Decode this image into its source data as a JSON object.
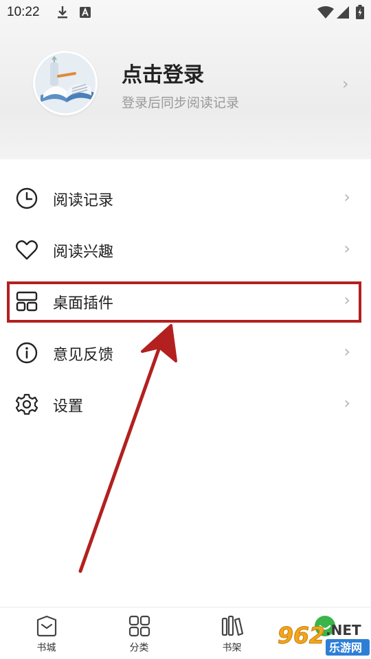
{
  "status_bar": {
    "time": "10:22",
    "icons": [
      "download-icon",
      "a-icon",
      "wifi-icon",
      "signal-icon",
      "battery-icon"
    ]
  },
  "profile": {
    "title": "点击登录",
    "subtitle": "登录后同步阅读记录",
    "avatar_icon": "book-avatar-icon"
  },
  "menu": {
    "items": [
      {
        "label": "阅读记录",
        "icon": "clock-icon"
      },
      {
        "label": "阅读兴趣",
        "icon": "heart-icon"
      },
      {
        "label": "桌面插件",
        "icon": "widget-icon"
      },
      {
        "label": "意见反馈",
        "icon": "info-icon"
      },
      {
        "label": "设置",
        "icon": "gear-icon"
      }
    ],
    "highlighted_item": "桌面插件"
  },
  "annotation": {
    "highlight_color": "#b3201f"
  },
  "bottom_nav": {
    "items": [
      {
        "label": "书城",
        "icon": "bookstore-icon"
      },
      {
        "label": "分类",
        "icon": "category-grid-icon"
      },
      {
        "label": "书架",
        "icon": "bookshelf-icon"
      },
      {
        "label": "",
        "icon": "profile-icon"
      }
    ]
  },
  "watermark": {
    "text": "962.NET",
    "subtext": "乐游网"
  }
}
